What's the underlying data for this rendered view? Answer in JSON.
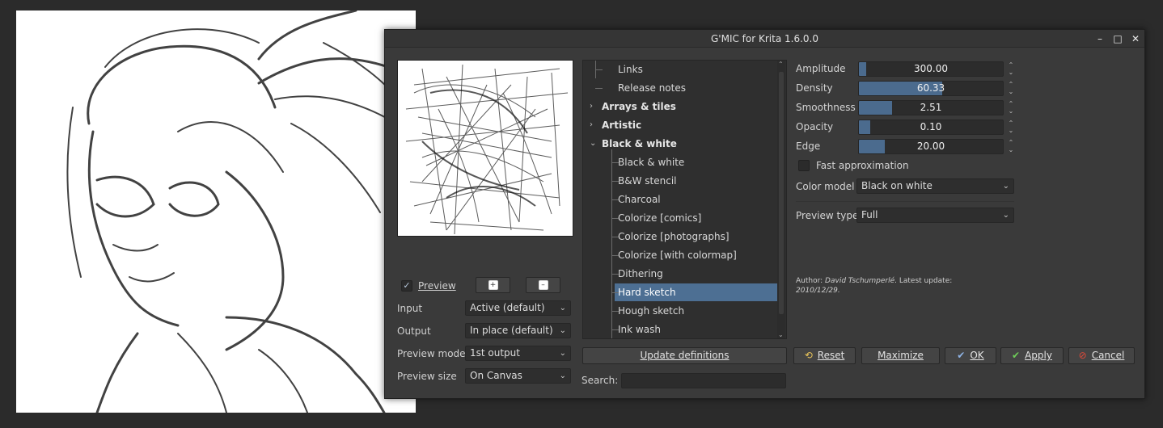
{
  "window": {
    "title": "G'MIC for Krita 1.6.0.0",
    "minimize_glyph": "–",
    "maximize_glyph": "□",
    "close_glyph": "✕"
  },
  "left_panel": {
    "preview_label": "Preview",
    "preview_checked": true,
    "input": {
      "label": "Input",
      "value": "Active (default)"
    },
    "output": {
      "label": "Output",
      "value": "In place (default)"
    },
    "preview_mode": {
      "label": "Preview mode",
      "value": "1st output"
    },
    "preview_size": {
      "label": "Preview size",
      "value": "On Canvas"
    }
  },
  "tree": {
    "items": [
      {
        "label": "Links",
        "type": "leaf"
      },
      {
        "label": "Release notes",
        "type": "leaf"
      },
      {
        "label": "Arrays & tiles",
        "type": "category",
        "expanded": false
      },
      {
        "label": "Artistic",
        "type": "category",
        "expanded": false
      },
      {
        "label": "Black & white",
        "type": "category",
        "expanded": true
      },
      {
        "label": "Black & white",
        "type": "leaf"
      },
      {
        "label": "B&W stencil",
        "type": "leaf"
      },
      {
        "label": "Charcoal",
        "type": "leaf"
      },
      {
        "label": "Colorize [comics]",
        "type": "leaf"
      },
      {
        "label": "Colorize [photographs]",
        "type": "leaf"
      },
      {
        "label": "Colorize [with colormap]",
        "type": "leaf"
      },
      {
        "label": "Dithering",
        "type": "leaf"
      },
      {
        "label": "Hard sketch",
        "type": "leaf",
        "selected": true
      },
      {
        "label": "Hough sketch",
        "type": "leaf"
      },
      {
        "label": "Ink wash",
        "type": "leaf"
      }
    ],
    "update_button": "Update definitions",
    "search_label": "Search:",
    "search_value": ""
  },
  "params": {
    "sliders": [
      {
        "label": "Amplitude",
        "value": "300.00",
        "fraction": 0.05
      },
      {
        "label": "Density",
        "value": "60.33",
        "fraction": 0.58
      },
      {
        "label": "Smoothness",
        "value": "2.51",
        "fraction": 0.23
      },
      {
        "label": "Opacity",
        "value": "0.10",
        "fraction": 0.08
      },
      {
        "label": "Edge",
        "value": "20.00",
        "fraction": 0.18
      }
    ],
    "fast_approx_label": "Fast approximation",
    "fast_approx_checked": false,
    "color_model": {
      "label": "Color model",
      "value": "Black on white"
    },
    "preview_type": {
      "label": "Preview type",
      "value": "Full"
    },
    "author_prefix": "Author: ",
    "author_name": "David Tschumperlé",
    "author_suffix": ". Latest update:",
    "author_date": "2010/12/29."
  },
  "buttons": {
    "reset": "Reset",
    "maximize": "Maximize",
    "ok": "OK",
    "apply": "Apply",
    "cancel": "Cancel"
  },
  "colors": {
    "accent": "#4d6f93",
    "slider_fill": "#4b6b8e",
    "dialog_bg": "#3a3a3a"
  }
}
